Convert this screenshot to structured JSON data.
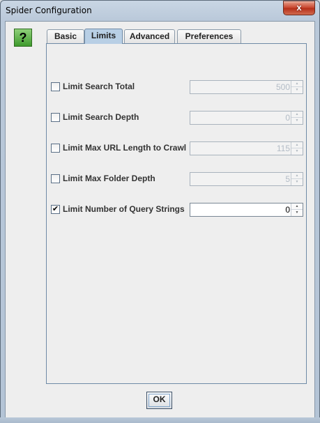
{
  "window": {
    "title": "Spider Configuration",
    "close_glyph": "x"
  },
  "help": {
    "icon": "question-mark-icon",
    "glyph": "?"
  },
  "tabs": [
    {
      "label": "Basic",
      "active": false
    },
    {
      "label": "Limits",
      "active": true
    },
    {
      "label": "Advanced",
      "active": false
    },
    {
      "label": "Preferences",
      "active": false
    }
  ],
  "limits": [
    {
      "label": "Limit Search Total",
      "checked": false,
      "value": "500",
      "enabled": false
    },
    {
      "label": "Limit Search Depth",
      "checked": false,
      "value": "0",
      "enabled": false
    },
    {
      "label": "Limit Max URL Length to Crawl",
      "checked": false,
      "value": "115",
      "enabled": false
    },
    {
      "label": "Limit Max Folder Depth",
      "checked": false,
      "value": "5",
      "enabled": false
    },
    {
      "label": "Limit Number of Query Strings",
      "checked": true,
      "value": "0",
      "enabled": true
    }
  ],
  "footer": {
    "ok_label": "OK"
  },
  "colors": {
    "active_tab": "#b8cfe5",
    "help_green": "#3e9a2c",
    "close_red": "#c7432b"
  }
}
